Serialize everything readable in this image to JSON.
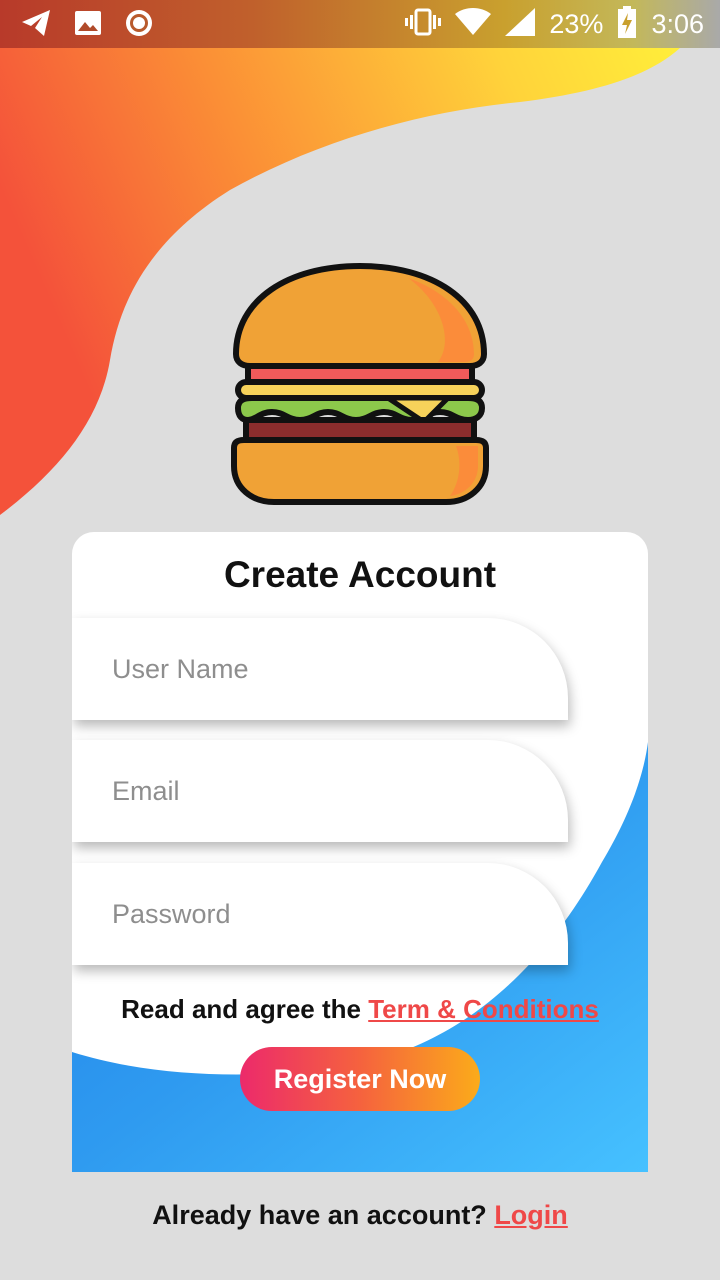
{
  "status_bar": {
    "icons_left": [
      "telegram-icon",
      "image-icon",
      "record-icon"
    ],
    "icons_right": [
      "vibrate-icon",
      "wifi-icon",
      "signal-icon",
      "battery-charging-icon"
    ],
    "battery_percent": "23%",
    "time": "3:06"
  },
  "logo": {
    "icon": "burger-icon"
  },
  "form": {
    "title": "Create Account",
    "username_placeholder": "User Name",
    "username_value": "",
    "email_placeholder": "Email",
    "email_value": "",
    "password_placeholder": "Password",
    "password_value": "",
    "agree_text": "Read and agree the ",
    "terms_link": "Term & Conditions",
    "register_label": "Register Now"
  },
  "footer": {
    "prompt": "Already have an account? ",
    "login_link": "Login"
  },
  "colors": {
    "background": "#dddddd",
    "swoosh_start": "#f4523a",
    "swoosh_end": "#ffe83a",
    "wave_blue": "#2f9bf0",
    "link_red": "#ef4848",
    "button_start": "#ec2a6b",
    "button_end": "#fbab1a"
  }
}
